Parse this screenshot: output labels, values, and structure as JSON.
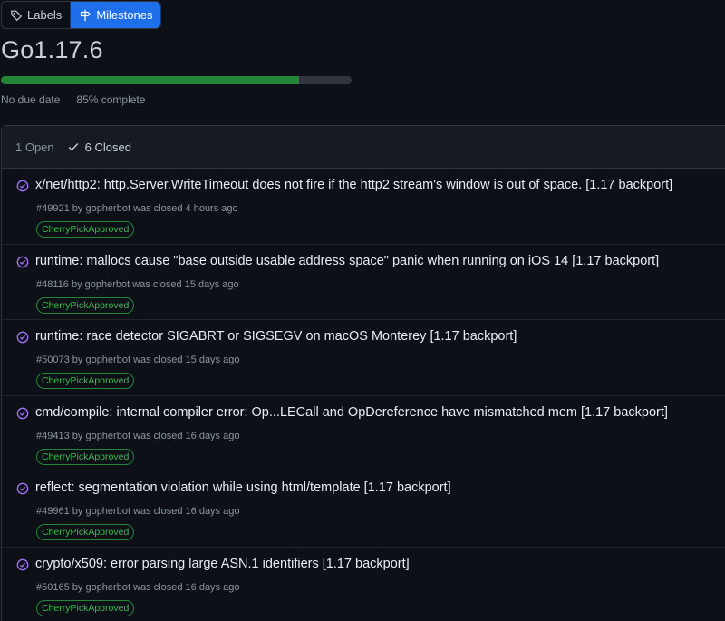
{
  "nav": {
    "labels_label": "Labels",
    "milestones_label": "Milestones"
  },
  "milestone": {
    "title": "Go1.17.6",
    "due": "No due date",
    "percent_text": "85% complete",
    "progress_fraction": 0.85
  },
  "filter": {
    "open_label": "1 Open",
    "closed_label": "6 Closed"
  },
  "colors": {
    "accent": "#1f6feb",
    "progress": "#238636",
    "closed_icon": "#a371f7",
    "label": "#3fb950"
  },
  "issues": [
    {
      "title": "x/net/http2: http.Server.WriteTimeout does not fire if the http2 stream's window is out of space. [1.17 backport]",
      "number": "#49921",
      "author": "gopherbot",
      "closed": "was closed 4 hours ago",
      "label": "CherryPickApproved"
    },
    {
      "title": "runtime: mallocs cause \"base outside usable address space\" panic when running on iOS 14 [1.17 backport]",
      "number": "#48116",
      "author": "gopherbot",
      "closed": "was closed 15 days ago",
      "label": "CherryPickApproved"
    },
    {
      "title": "runtime: race detector SIGABRT or SIGSEGV on macOS Monterey [1.17 backport]",
      "number": "#50073",
      "author": "gopherbot",
      "closed": "was closed 15 days ago",
      "label": "CherryPickApproved"
    },
    {
      "title": "cmd/compile: internal compiler error: Op...LECall and OpDereference have mismatched mem [1.17 backport]",
      "number": "#49413",
      "author": "gopherbot",
      "closed": "was closed 16 days ago",
      "label": "CherryPickApproved"
    },
    {
      "title": "reflect: segmentation violation while using html/template [1.17 backport]",
      "number": "#49961",
      "author": "gopherbot",
      "closed": "was closed 16 days ago",
      "label": "CherryPickApproved"
    },
    {
      "title": "crypto/x509: error parsing large ASN.1 identifiers [1.17 backport]",
      "number": "#50165",
      "author": "gopherbot",
      "closed": "was closed 16 days ago",
      "label": "CherryPickApproved"
    }
  ]
}
